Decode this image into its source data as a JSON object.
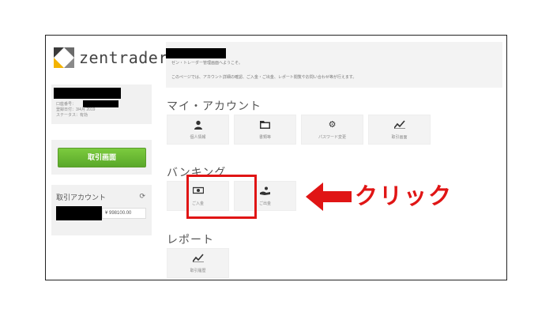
{
  "brand": {
    "name": "zentrader"
  },
  "profile": {
    "line1": "口座番号：",
    "line2": "登録日付：3/4月 2019",
    "line3": "ステータス：有効"
  },
  "sidebar": {
    "trade_button": "取引画面",
    "account_title": "取引アカウント",
    "balance": "¥ 998100.00"
  },
  "welcome": {
    "line1": "ゼン・トレーダー管理画面へようこそ。",
    "line2": "このページでは、アカウント詳細の確認、ご入金・ご出金、レポート閲覧やお問い合わせ等が行えます。"
  },
  "sections": {
    "my_account": {
      "title": "マイ・アカウント",
      "tiles": [
        {
          "label": "個人情報",
          "icon": "person-icon"
        },
        {
          "label": "書類等",
          "icon": "folder-icon"
        },
        {
          "label": "パスワード変更",
          "icon": "gears-icon"
        },
        {
          "label": "取引画面",
          "icon": "chart-icon"
        }
      ]
    },
    "banking": {
      "title": "バンキング",
      "tiles": [
        {
          "label": "ご入金",
          "icon": "money-icon"
        },
        {
          "label": "ご出金",
          "icon": "withdraw-icon"
        }
      ]
    },
    "report": {
      "title": "レポート",
      "tiles": [
        {
          "label": "取引履歴",
          "icon": "chart-icon"
        }
      ]
    }
  },
  "annotation": {
    "text": "クリック",
    "color": "#e01515"
  }
}
